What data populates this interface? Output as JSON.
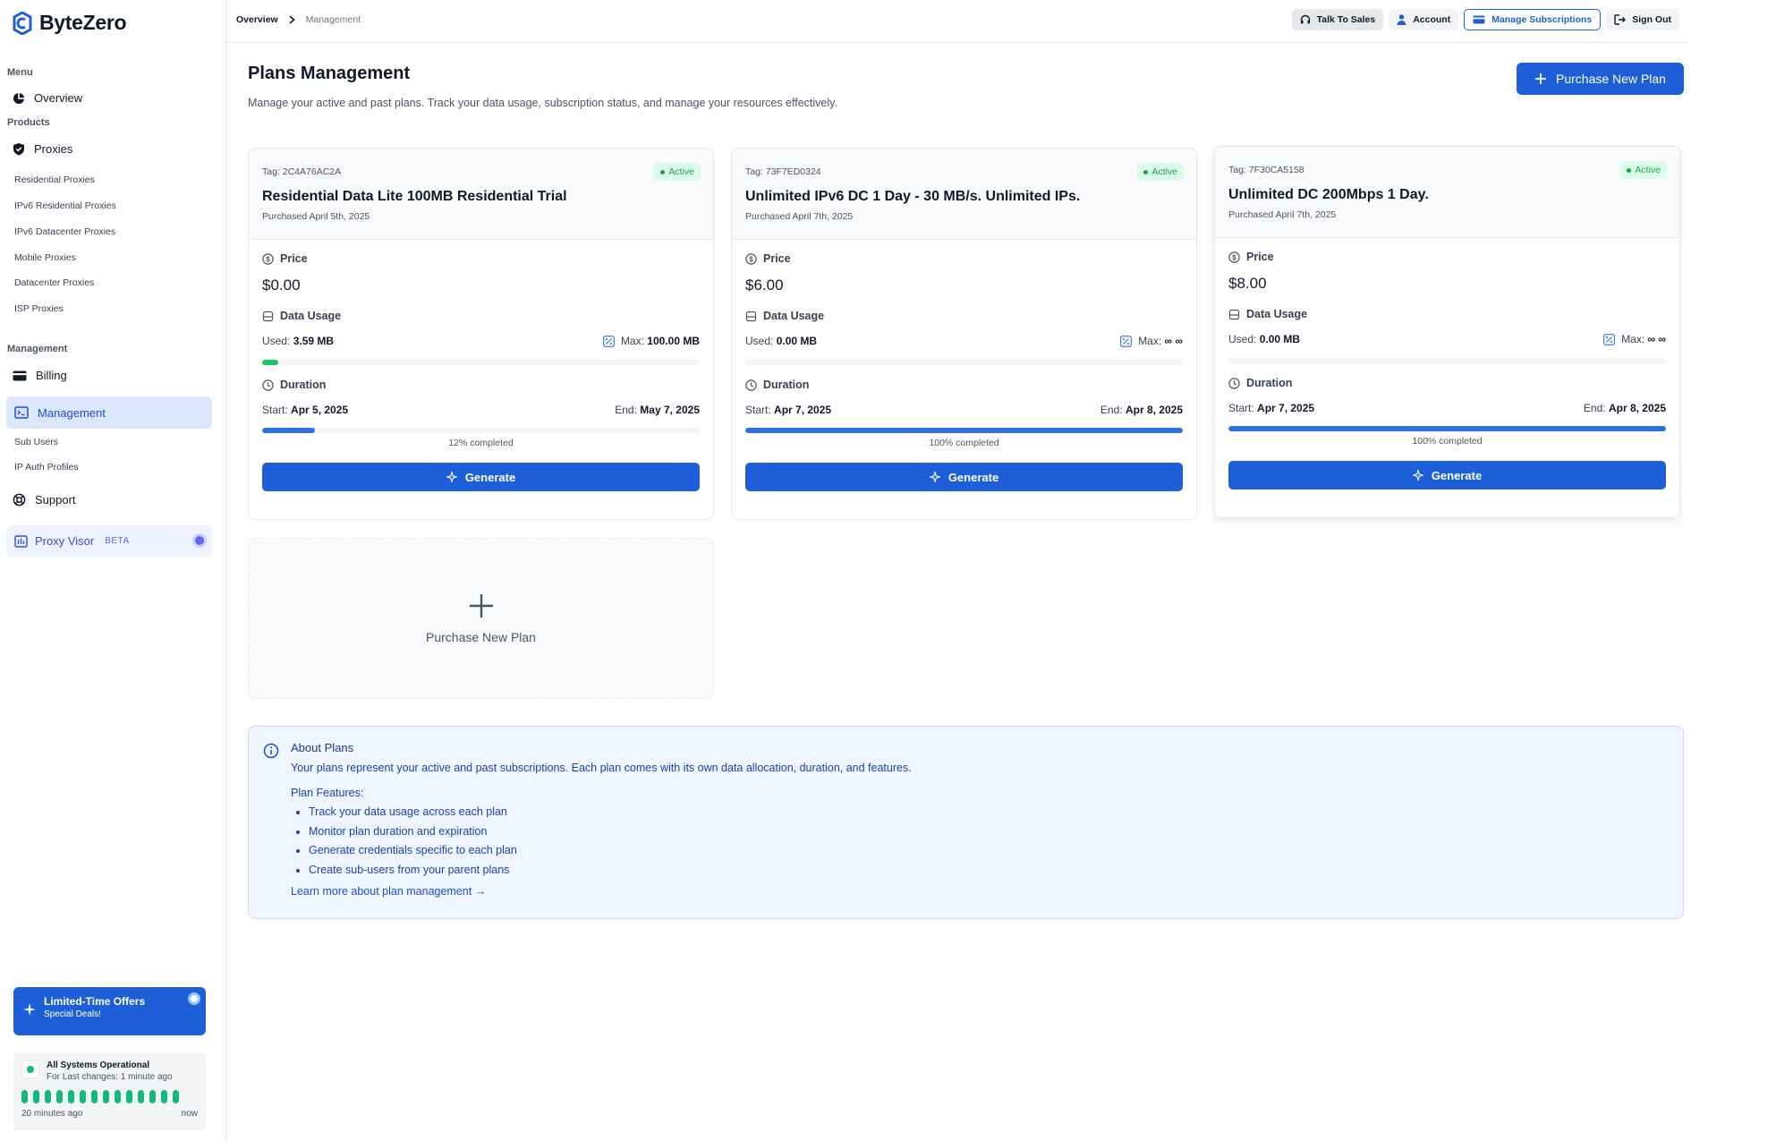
{
  "brand": {
    "name": "ByteZero"
  },
  "sidebar": {
    "menu_label": "Menu",
    "overview": "Overview",
    "products_label": "Products",
    "proxies": "Proxies",
    "proxy_items": [
      "Residential Proxies",
      "IPv6 Residential Proxies",
      "IPv6 Datacenter Proxies",
      "Mobile Proxies",
      "Datacenter Proxies",
      "ISP Proxies"
    ],
    "management_label": "Management",
    "billing": "Billing",
    "management": "Management",
    "management_items": [
      "Sub Users",
      "IP Auth Profiles"
    ],
    "support": "Support",
    "proxy_visor": "Proxy Visor",
    "proxy_visor_badge": "BETA"
  },
  "offer": {
    "title": "Limited-Time Offers",
    "subtitle": "Special Deals!"
  },
  "system_status": {
    "title": "All Systems Operational",
    "subtitle": "For Last changes: 1 minute ago",
    "from": "20 minutes ago",
    "to": "now",
    "bar_color": "#10b981"
  },
  "breadcrumb": [
    "Overview",
    "Management"
  ],
  "topbar": {
    "talk_to_sales": "Talk To Sales",
    "account": "Account",
    "manage_subscriptions": "Manage Subscriptions",
    "sign_out": "Sign Out"
  },
  "page": {
    "title": "Plans Management",
    "description": "Manage your active and past plans. Track your data usage, subscription status, and manage your resources effectively.",
    "purchase_button": "Purchase New Plan"
  },
  "labels": {
    "price": "Price",
    "data_usage": "Data Usage",
    "duration": "Duration",
    "used": "Used:",
    "max": "Max:",
    "start": "Start:",
    "end": "End:",
    "generate": "Generate"
  },
  "plans": [
    {
      "tag": "Tag: 2C4A76AC2A",
      "status": "Active",
      "name": "Residential Data Lite 100MB Residential Trial",
      "purchased": "Purchased April 5th, 2025",
      "price": "$0.00",
      "used": "3.59 MB",
      "max": "100.00 MB",
      "usage_fraction": 0.0359,
      "start": "Apr 5, 2025",
      "end": "May 7, 2025",
      "completion_fraction": 0.12,
      "completed_text": "12% completed"
    },
    {
      "tag": "Tag: 73F7ED0324",
      "status": "Active",
      "name": "Unlimited IPv6 DC 1 Day - 30 MB/s. Unlimited IPs.",
      "purchased": "Purchased April 7th, 2025",
      "price": "$6.00",
      "used": "0.00 MB",
      "max": "∞ ∞",
      "usage_fraction": 0,
      "start": "Apr 7, 2025",
      "end": "Apr 8, 2025",
      "completion_fraction": 1.0,
      "completed_text": "100% completed"
    },
    {
      "tag": "Tag: 7F30CA5158",
      "status": "Active",
      "name": "Unlimited DC 200Mbps 1 Day.",
      "purchased": "Purchased April 7th, 2025",
      "price": "$8.00",
      "used": "0.00 MB",
      "max": "∞ ∞",
      "usage_fraction": 0,
      "start": "Apr 7, 2025",
      "end": "Apr 8, 2025",
      "completion_fraction": 1.0,
      "completed_text": "100% completed"
    }
  ],
  "new_plan_card": {
    "label": "Purchase New Plan"
  },
  "about": {
    "title": "About Plans",
    "text": "Your plans represent your active and past subscriptions. Each plan comes with its own data allocation, duration, and features.",
    "features_title": "Plan Features:",
    "features": [
      "Track your data usage across each plan",
      "Monitor plan duration and expiration",
      "Generate credentials specific to each plan",
      "Create sub-users from your parent plans"
    ],
    "link": "Learn more about plan management →"
  },
  "colors": {
    "primary": "#1d5fd9",
    "usage_green": "#22c55e",
    "progress_blue": "#2f6fe0"
  }
}
